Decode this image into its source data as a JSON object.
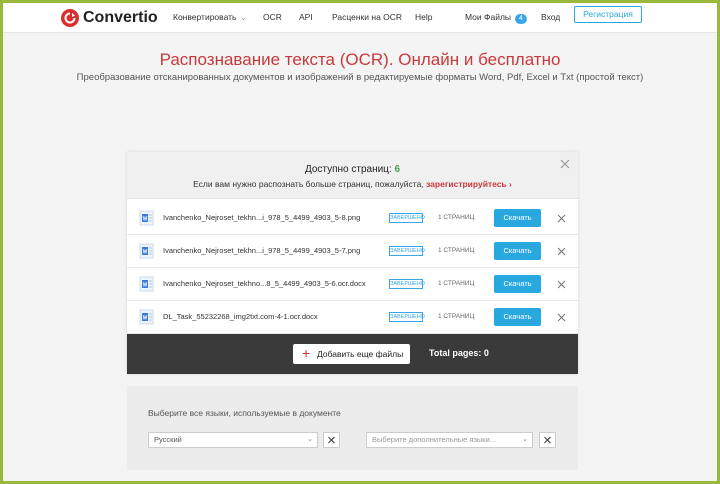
{
  "header": {
    "logo": "Convertio",
    "nav": {
      "convert": "Конвертировать",
      "ocr": "OCR",
      "api": "API",
      "pricing": "Расценки на OCR",
      "help": "Help",
      "my_files": "Мои Файлы",
      "my_files_count": "4",
      "login": "Вход",
      "register": "Регистрация"
    }
  },
  "hero": {
    "title": "Распознавание текста (OCR). Онлайн и бесплатно",
    "subtitle": "Преобразование отсканированных документов и изображений в редактируемые форматы Word, Pdf, Excel и Txt (простой текст)"
  },
  "notice": {
    "available_label": "Доступно страниц:",
    "available_count": "6",
    "text": "Если вам нужно распознать больше страниц, пожалуйста,",
    "link": "зарегистрируйтесь",
    "link_arrow": "›"
  },
  "files": [
    {
      "name": "Ivanchenko_Nejroset_tekhn...i_978_5_4499_4903_5-8.png",
      "status": "ЗАВЕРШЕНО",
      "pages": "1 СТРАНИЦ",
      "action": "Скачать"
    },
    {
      "name": "Ivanchenko_Nejroset_tekhn...i_978_5_4499_4903_5-7.png",
      "status": "ЗАВЕРШЕНО",
      "pages": "1 СТРАНИЦ",
      "action": "Скачать"
    },
    {
      "name": "Ivanchenko_Nejroset_tekhno...8_5_4499_4903_5-6.ocr.docx",
      "status": "ЗАВЕРШЕНО",
      "pages": "1 СТРАНИЦ",
      "action": "Скачать"
    },
    {
      "name": "DL_Task_55232268_img2txt.com-4-1.ocr.docx",
      "status": "ЗАВЕРШЕНО",
      "pages": "1 СТРАНИЦ",
      "action": "Скачать"
    }
  ],
  "footer_bar": {
    "add_more": "Добавить еще файлы",
    "total_pages": "Total pages: 0"
  },
  "language": {
    "label": "Выберите все языки, используемые в документе",
    "primary_value": "Русский",
    "secondary_placeholder": "Выберите дополнительные языки..."
  },
  "colors": {
    "accent_red": "#c8383b",
    "accent_blue": "#29a8e0",
    "success_green": "#44a84a",
    "bar_dark": "#3a3a3a"
  }
}
